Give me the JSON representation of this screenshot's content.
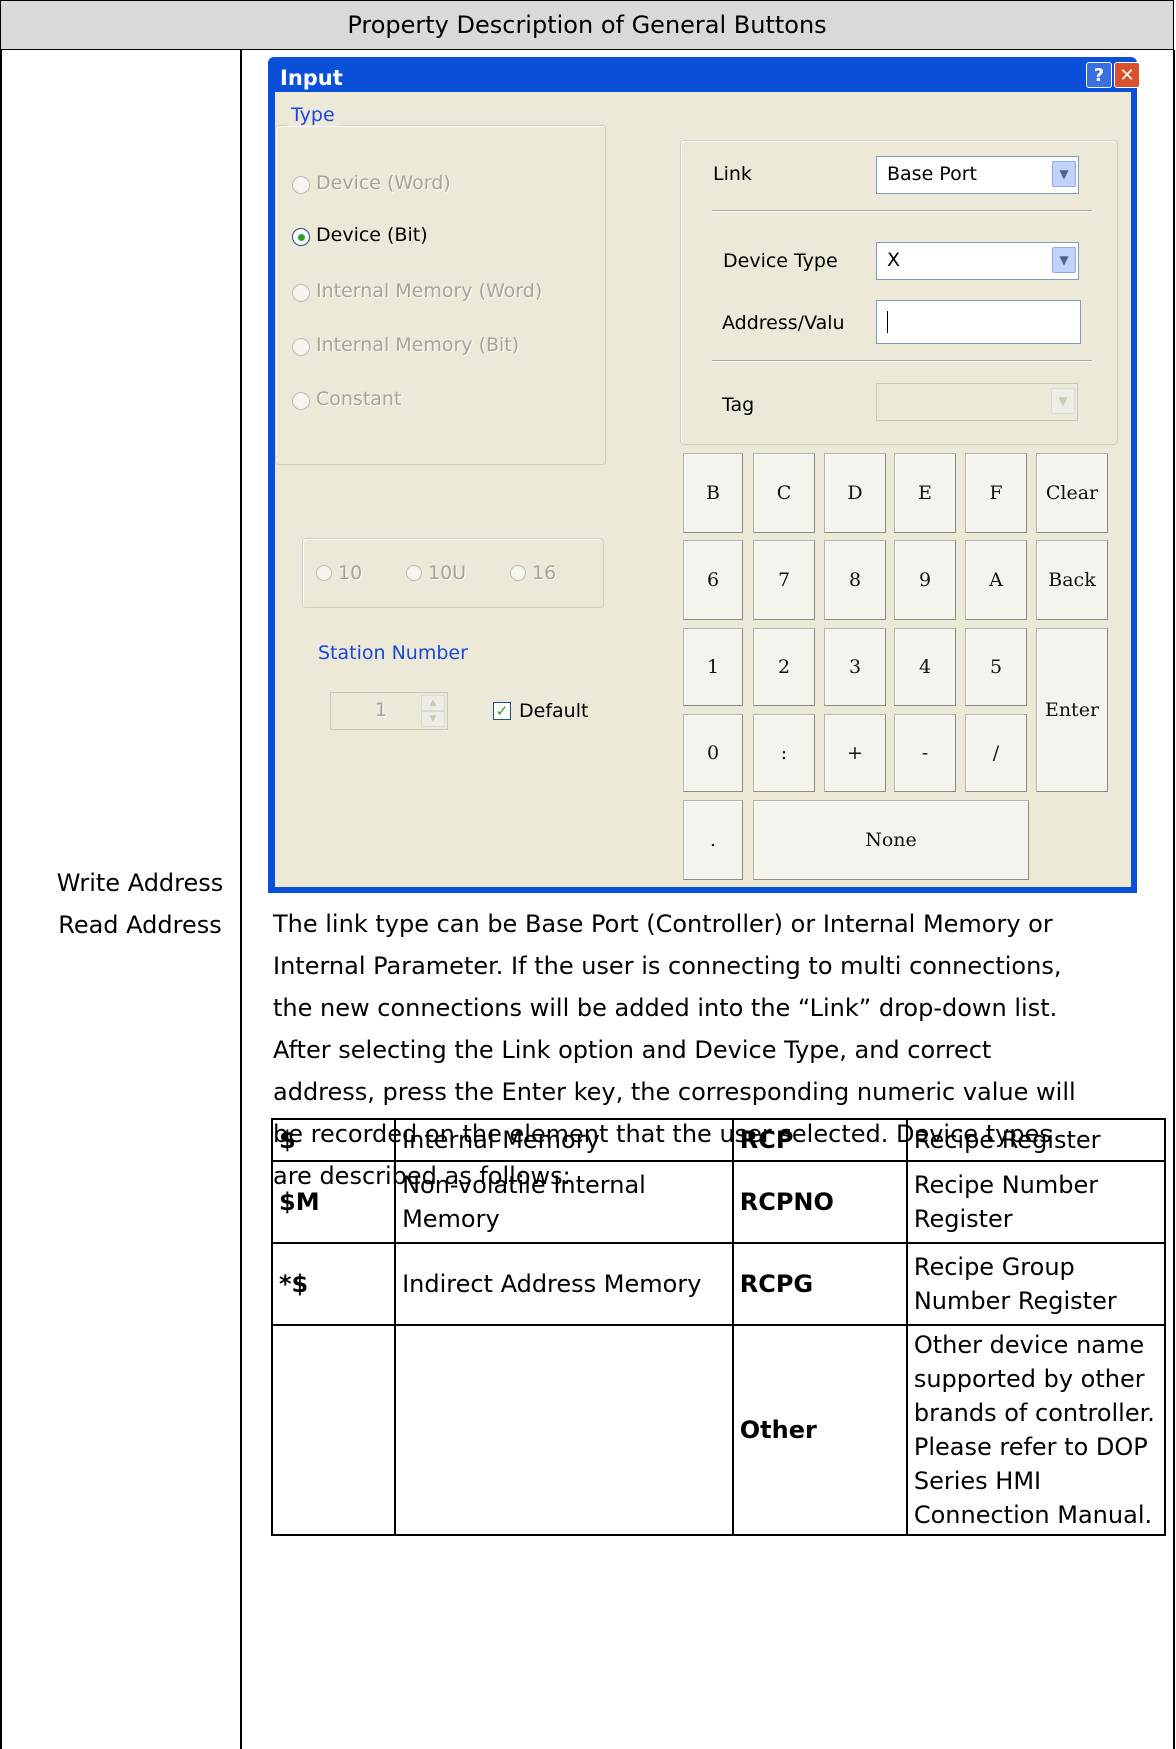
{
  "header": {
    "title": "Property Description of General Buttons"
  },
  "left_label": {
    "line1": "Write Address",
    "line2": "Read Address"
  },
  "dialog": {
    "title": "Input",
    "help_glyph": "?",
    "close_glyph": "✕",
    "type_group": {
      "label": "Type",
      "options": [
        {
          "label": "Device (Word)",
          "selected": false,
          "enabled": false
        },
        {
          "label": "Device (Bit)",
          "selected": true,
          "enabled": true
        },
        {
          "label": "Internal Memory (Word)",
          "selected": false,
          "enabled": false
        },
        {
          "label": "Internal Memory (Bit)",
          "selected": false,
          "enabled": false
        },
        {
          "label": "Constant",
          "selected": false,
          "enabled": false
        }
      ]
    },
    "format_options": [
      "10",
      "10U",
      "16"
    ],
    "station": {
      "label": "Station Number",
      "value": "1",
      "default_label": "Default",
      "default_checked": true
    },
    "link": {
      "label": "Link",
      "value": "Base Port"
    },
    "device_type": {
      "label": "Device Type",
      "value": "X"
    },
    "address": {
      "label": "Address/Valu",
      "value": ""
    },
    "tag": {
      "label": "Tag",
      "value": ""
    },
    "keypad": {
      "row1": [
        "B",
        "C",
        "D",
        "E",
        "F",
        "Clear"
      ],
      "row2": [
        "6",
        "7",
        "8",
        "9",
        "A",
        "Back"
      ],
      "row3": [
        "1",
        "2",
        "3",
        "4",
        "5"
      ],
      "row4": [
        "0",
        ":",
        "+",
        "-",
        "/"
      ],
      "enter": "Enter",
      "dot": ".",
      "none": "None"
    }
  },
  "description": {
    "lines": [
      "The link type can be Base Port (Controller) or Internal Memory or",
      "Internal Parameter. If the user is connecting to multi connections,",
      "the new connections will be added into the “Link” drop-down list.",
      "After selecting the Link option and Device Type, and correct",
      "address, press the Enter key, the corresponding numeric value will",
      "be recorded on the element that the user selected. Device types",
      "are described as follows:"
    ]
  },
  "device_types": [
    {
      "code1": "$",
      "desc1": "Internal Memory",
      "code2": "RCP",
      "desc2": "Recipe Register"
    },
    {
      "code1": "$M",
      "desc1": "Non-volatile Internal Memory",
      "code2": "RCPNO",
      "desc2": "Recipe Number Register"
    },
    {
      "code1": "*$",
      "desc1": "Indirect Address Memory",
      "code2": "RCPG",
      "desc2": "Recipe Group Number Register"
    },
    {
      "code1": "",
      "desc1": "",
      "code2": "Other",
      "desc2": "Other device name supported by other brands of controller. Please refer to DOP Series HMI Connection Manual."
    }
  ]
}
